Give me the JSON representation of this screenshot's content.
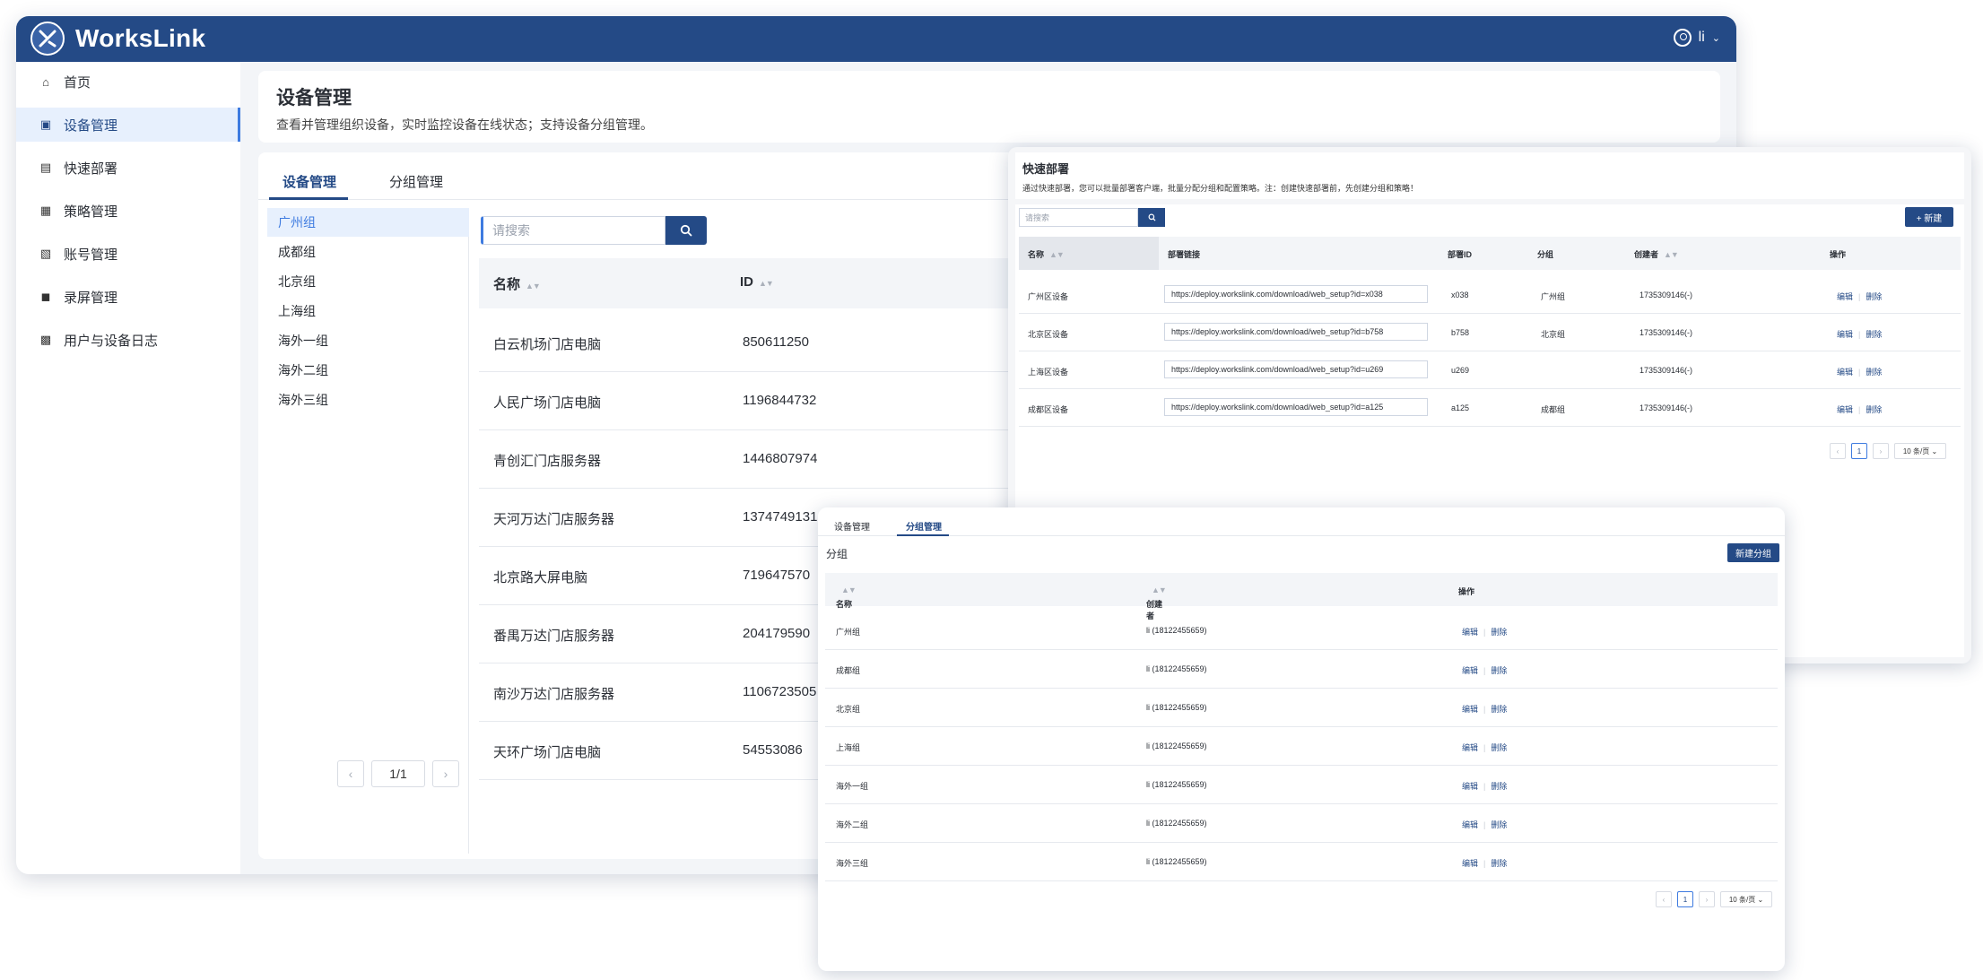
{
  "app": {
    "name": "WorksLink",
    "user": "li"
  },
  "sidebar": {
    "items": [
      {
        "label": "首页",
        "icon": "home-icon"
      },
      {
        "label": "设备管理",
        "icon": "monitor-icon"
      },
      {
        "label": "快速部署",
        "icon": "deploy-icon"
      },
      {
        "label": "策略管理",
        "icon": "policy-icon"
      },
      {
        "label": "账号管理",
        "icon": "account-icon"
      },
      {
        "label": "录屏管理",
        "icon": "video-icon"
      },
      {
        "label": "用户与设备日志",
        "icon": "log-icon"
      }
    ]
  },
  "page": {
    "title": "设备管理",
    "description": "查看并管理组织设备，实时监控设备在线状态；支持设备分组管理。"
  },
  "tabs": [
    "设备管理",
    "分组管理"
  ],
  "groups": [
    "广州组",
    "成都组",
    "北京组",
    "上海组",
    "海外一组",
    "海外二组",
    "海外三组"
  ],
  "group_pager": "1/1",
  "search": {
    "placeholder": "请搜索"
  },
  "device_table": {
    "columns": [
      "名称",
      "ID"
    ],
    "rows": [
      {
        "name": "白云机场门店电脑",
        "id": "850611250"
      },
      {
        "name": "人民广场门店电脑",
        "id": "1196844732"
      },
      {
        "name": "青创汇门店服务器",
        "id": "1446807974"
      },
      {
        "name": "天河万达门店服务器",
        "id": "1374749131"
      },
      {
        "name": "北京路大屏电脑",
        "id": "719647570"
      },
      {
        "name": "番禺万达门店服务器",
        "id": "204179590"
      },
      {
        "name": "南沙万达门店服务器",
        "id": "1106723505"
      },
      {
        "name": "天环广场门店电脑",
        "id": "54553086"
      }
    ]
  },
  "deploy": {
    "title": "快速部署",
    "description": "通过快速部署，您可以批量部署客户端，批量分配分组和配置策略。注：创建快速部署前，先创建分组和策略！",
    "search_placeholder": "请搜索",
    "new_label": "+ 新建",
    "columns": [
      "名称",
      "部署链接",
      "部署ID",
      "分组",
      "创建者",
      "操作"
    ],
    "rows": [
      {
        "name": "广州区设备",
        "link": "https://deploy.workslink.com/download/web_setup?id=x038",
        "deploy_id": "x038",
        "group": "广州组",
        "creator": "1735309146(-)"
      },
      {
        "name": "北京区设备",
        "link": "https://deploy.workslink.com/download/web_setup?id=b758",
        "deploy_id": "b758",
        "group": "北京组",
        "creator": "1735309146(-)"
      },
      {
        "name": "上海区设备",
        "link": "https://deploy.workslink.com/download/web_setup?id=u269",
        "deploy_id": "u269",
        "group": "",
        "creator": "1735309146(-)"
      },
      {
        "name": "成都区设备",
        "link": "https://deploy.workslink.com/download/web_setup?id=a125",
        "deploy_id": "a125",
        "group": "成都组",
        "creator": "1735309146(-)"
      }
    ],
    "edit": "编辑",
    "delete": "删除",
    "page": "1",
    "page_size": "10 条/页"
  },
  "group_mgmt": {
    "tabs": [
      "设备管理",
      "分组管理"
    ],
    "section": "分组",
    "new_label": "新建分组",
    "columns": [
      "名称",
      "创建者",
      "操作"
    ],
    "rows": [
      {
        "name": "广州组",
        "creator": "li (18122455659)"
      },
      {
        "name": "成都组",
        "creator": "li (18122455659)"
      },
      {
        "name": "北京组",
        "creator": "li (18122455659)"
      },
      {
        "name": "上海组",
        "creator": "li (18122455659)"
      },
      {
        "name": "海外一组",
        "creator": "li (18122455659)"
      },
      {
        "name": "海外二组",
        "creator": "li (18122455659)"
      },
      {
        "name": "海外三组",
        "creator": "li (18122455659)"
      }
    ],
    "edit": "编辑",
    "delete": "删除",
    "page": "1",
    "page_size": "10 条/页"
  },
  "colors": {
    "brand": "#244a86",
    "accent": "#3e7be0",
    "active_bg": "#e7f0fd"
  }
}
